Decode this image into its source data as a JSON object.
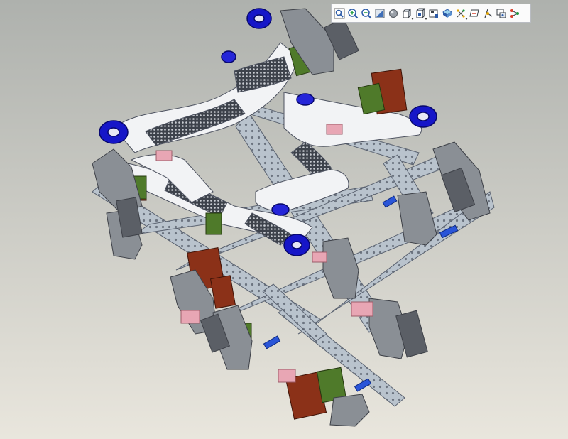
{
  "app": {
    "type": "cad-3d-viewport"
  },
  "scene": {
    "background_top": "#aeb1ad",
    "background_bottom": "#e9e6dd",
    "colors": {
      "frame_steel": "#b9c3cd",
      "frame_hole": "#6c7480",
      "subframe_white": "#f2f3f5",
      "mesh_dark": "#4a4f58",
      "bushing_blue": "#1616c8",
      "clamp_grey": "#8a8f95",
      "block_brown": "#8b3118",
      "block_green": "#4f7a2a",
      "pad_pink": "#e8a6b4",
      "cylinder_dark": "#5b5f66"
    }
  },
  "toolbar": {
    "buttons": [
      {
        "name": "refit-zoom",
        "icon": "refit-icon",
        "dropdown": false
      },
      {
        "name": "zoom-in",
        "icon": "zoom-in-icon",
        "dropdown": false
      },
      {
        "name": "zoom-out",
        "icon": "zoom-out-icon",
        "dropdown": false
      },
      {
        "name": "repaint",
        "icon": "repaint-icon",
        "dropdown": false
      },
      {
        "name": "shading",
        "icon": "shaded-sphere-icon",
        "dropdown": false
      },
      {
        "name": "display-style",
        "icon": "display-style-icon",
        "dropdown": true
      },
      {
        "name": "saved-orientations",
        "icon": "saved-views-icon",
        "dropdown": true
      },
      {
        "name": "view-manager",
        "icon": "view-manager-icon",
        "dropdown": false
      },
      {
        "name": "section",
        "icon": "section-icon",
        "dropdown": false
      },
      {
        "name": "datum-display",
        "icon": "datum-display-icon",
        "dropdown": true
      },
      {
        "name": "annotation-display",
        "icon": "annotation-icon",
        "dropdown": false
      },
      {
        "name": "spin-center",
        "icon": "spin-center-icon",
        "dropdown": false
      },
      {
        "name": "appearance",
        "icon": "appearance-icon",
        "dropdown": false
      },
      {
        "name": "model-tree-settings",
        "icon": "tree-settings-icon",
        "dropdown": false
      }
    ]
  }
}
